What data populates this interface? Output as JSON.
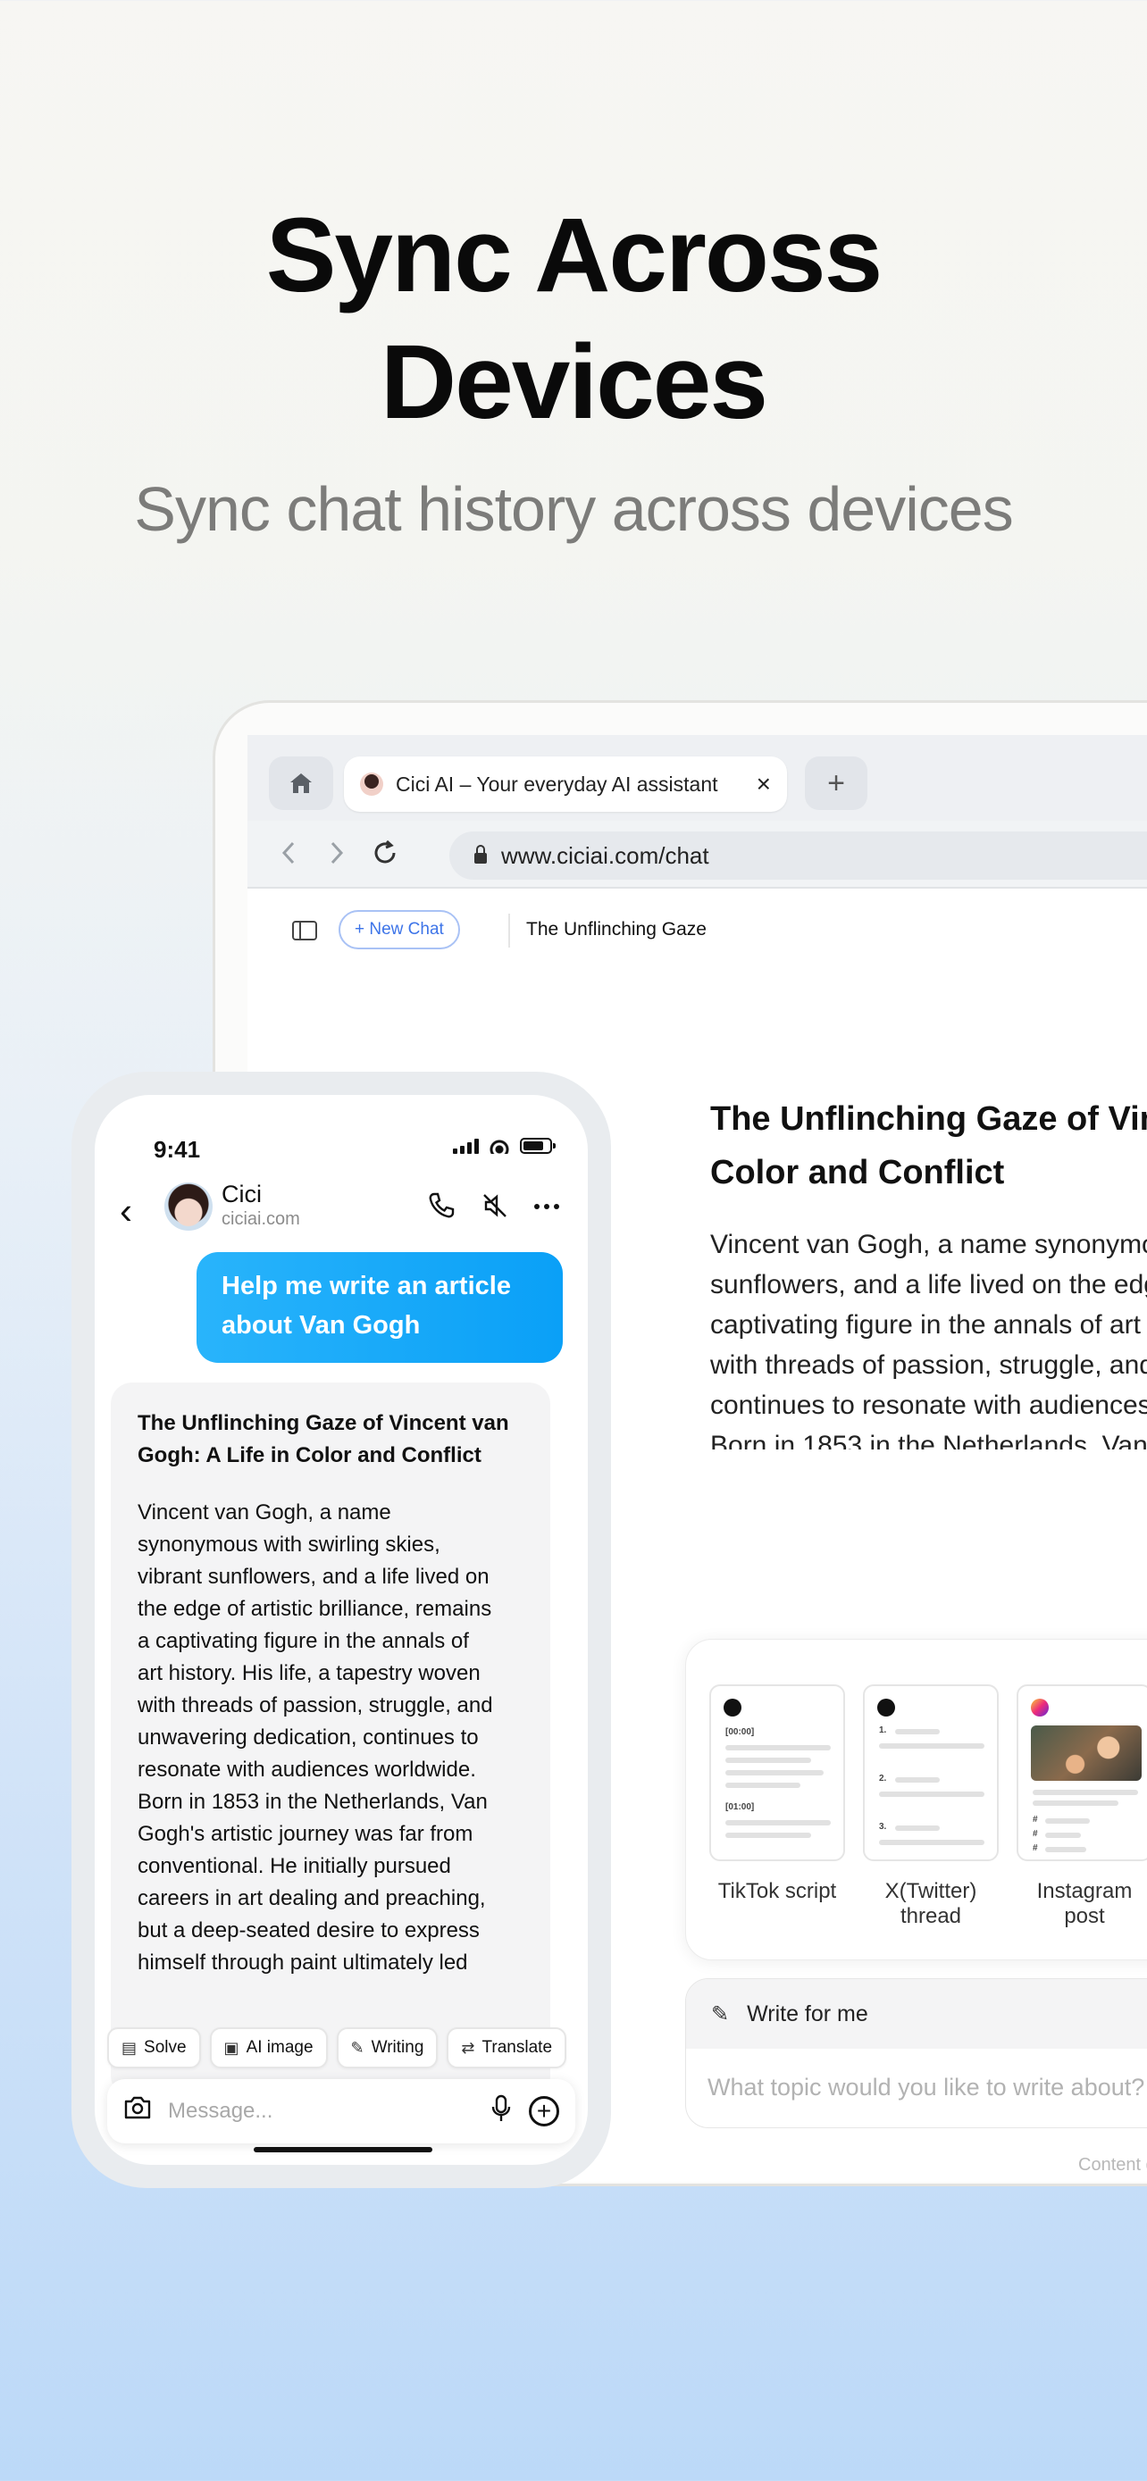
{
  "hero": {
    "title": "Sync Across\nDevices",
    "subtitle": "Sync chat history across devices"
  },
  "browser": {
    "tab_title": "Cici AI – Your everyday AI assistant",
    "tab_close": "×",
    "new_tab": "+",
    "url": "www.ciciai.com/chat",
    "new_chat_label": "+ New Chat",
    "chat_title": "The Unflinching Gaze",
    "article_title": "The Unflinching Gaze of Vincent van Gogh: A Life in\nColor and Conflict",
    "article_body": "Vincent van Gogh, a name synonymous with swirling skies, vibrant\nsunflowers, and a life lived on the edge of artistic brilliance, remains a\ncaptivating figure in the annals of art history. His life, a tapestry woven\nwith threads of passion, struggle, and unwavering dedication,\ncontinues to resonate with audiences worldwide.\nBorn in 1853 in the Netherlands, Van Gogh's artistic journey was far\nfrom conventional. He initially pursued careers in art dealing and\npreaching, but a deep-seated desire to express himself through paint\nultimately led him to dedicate his life to art. His early works,\ndepicting rural landscapes and laborers",
    "templates": [
      {
        "label": "TikTok script",
        "icon": "tiktok-icon"
      },
      {
        "label": "X(Twitter)\nthread",
        "icon": "x-icon"
      },
      {
        "label": "Instagram\npost",
        "icon": "instagram-icon"
      }
    ],
    "write_label": "Write for me",
    "write_placeholder": "What topic would you like to write about?",
    "disclaimer": "Content generated by AI"
  },
  "phone": {
    "time": "9:41",
    "bot_name": "Cici",
    "bot_site": "ciciai.com",
    "user_message": "Help me write an article\nabout Van Gogh",
    "reply_title": "The Unflinching Gaze of Vincent van\nGogh: A Life in Color and Conflict",
    "reply_body": "Vincent van Gogh, a name\nsynonymous with swirling skies,\nvibrant sunflowers, and a life lived on\nthe edge of artistic brilliance, remains\na captivating figure in the annals of\nart history. His life, a tapestry woven\nwith threads of passion, struggle, and\nunwavering dedication, continues to\nresonate with audiences worldwide.\nBorn in 1853 in the Netherlands, Van\nGogh's artistic journey was far from\nconventional. He initially pursued\ncareers in art dealing and preaching,\nbut a deep-seated desire to express\nhimself through paint ultimately led",
    "quick_actions": [
      "Solve",
      "AI image",
      "Writing",
      "Translate"
    ],
    "message_placeholder": "Message..."
  }
}
